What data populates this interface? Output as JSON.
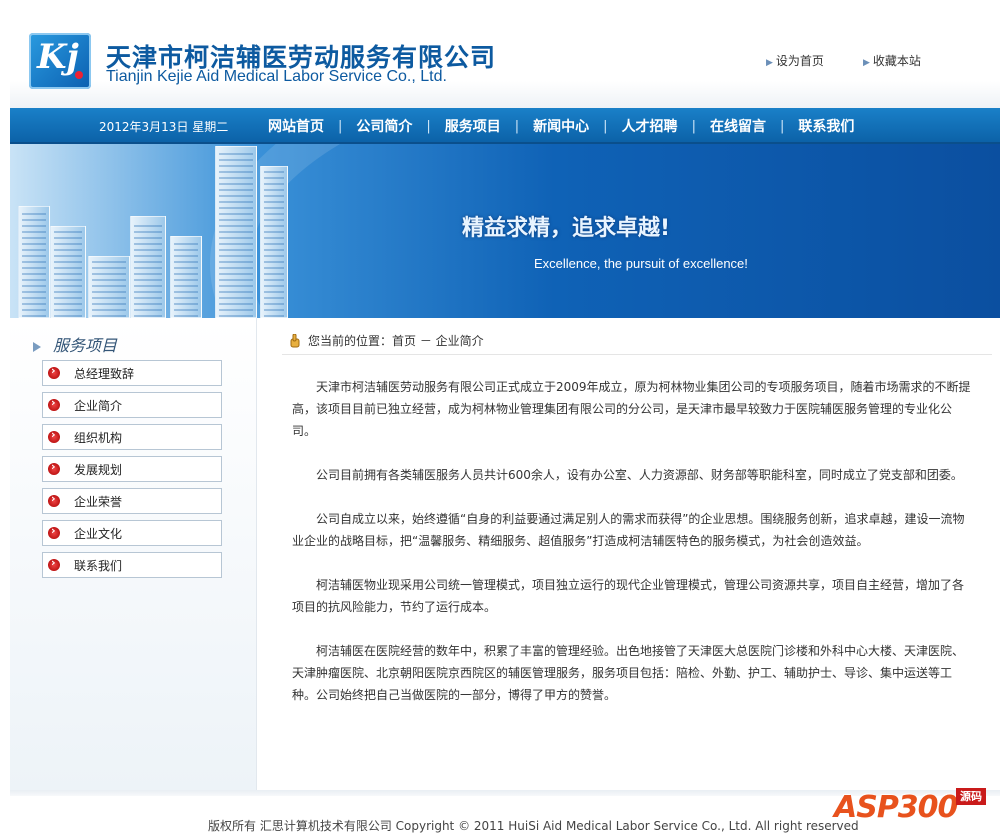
{
  "header": {
    "logo_letters": "Kj",
    "cn_name": "天津市柯洁辅医劳动服务有限公司",
    "en_name": "Tianjin Kejie Aid Medical Labor Service Co., Ltd.",
    "links": [
      "设为首页",
      "收藏本站"
    ]
  },
  "navbar": {
    "date": "2012年3月13日 星期二",
    "items": [
      "网站首页",
      "公司简介",
      "服务项目",
      "新闻中心",
      "人才招聘",
      "在线留言",
      "联系我们"
    ]
  },
  "banner": {
    "slogan_cn": "精益求精，追求卓越!",
    "slogan_en": "Excellence, the pursuit of excellence!"
  },
  "sidebar": {
    "title": "服务项目",
    "items": [
      "总经理致辞",
      "企业简介",
      "组织机构",
      "发展规划",
      "企业荣誉",
      "企业文化",
      "联系我们"
    ]
  },
  "main": {
    "breadcrumb": "您当前的位置：首页 － 企业简介",
    "paragraphs": [
      "天津市柯洁辅医劳动服务有限公司正式成立于2009年成立，原为柯林物业集团公司的专项服务项目，随着市场需求的不断提高，该项目目前已独立经营，成为柯林物业管理集团有限公司的分公司，是天津市最早较致力于医院辅医服务管理的专业化公司。",
      "公司目前拥有各类辅医服务人员共计600余人，设有办公室、人力资源部、财务部等职能科室，同时成立了党支部和团委。",
      "公司自成立以来，始终遵循“自身的利益要通过满足别人的需求而获得”的企业思想。围绕服务创新，追求卓越，建设一流物业企业的战略目标，把“温馨服务、精细服务、超值服务”打造成柯洁辅医特色的服务模式，为社会创造效益。",
      "柯洁辅医物业现采用公司统一管理模式，项目独立运行的现代企业管理模式，管理公司资源共享，项目自主经营，增加了各项目的抗风险能力，节约了运行成本。",
      "柯洁辅医在医院经营的数年中，积累了丰富的管理经验。出色地接管了天津医大总医院门诊楼和外科中心大楼、天津医院、天津肿瘤医院、北京朝阳医院京西院区的辅医管理服务，服务项目包括：陪检、外勤、护工、辅助护士、导诊、集中运送等工种。公司始终把自己当做医院的一部分，博得了甲方的赞誉。"
    ]
  },
  "footer": {
    "copyright": "版权所有  汇思计算机技术有限公司  Copyright © 2011 HuiSi Aid Medical Labor Service Co., Ltd. All right reserved"
  },
  "watermark": {
    "text": "ASP300",
    "tag": "源码"
  }
}
